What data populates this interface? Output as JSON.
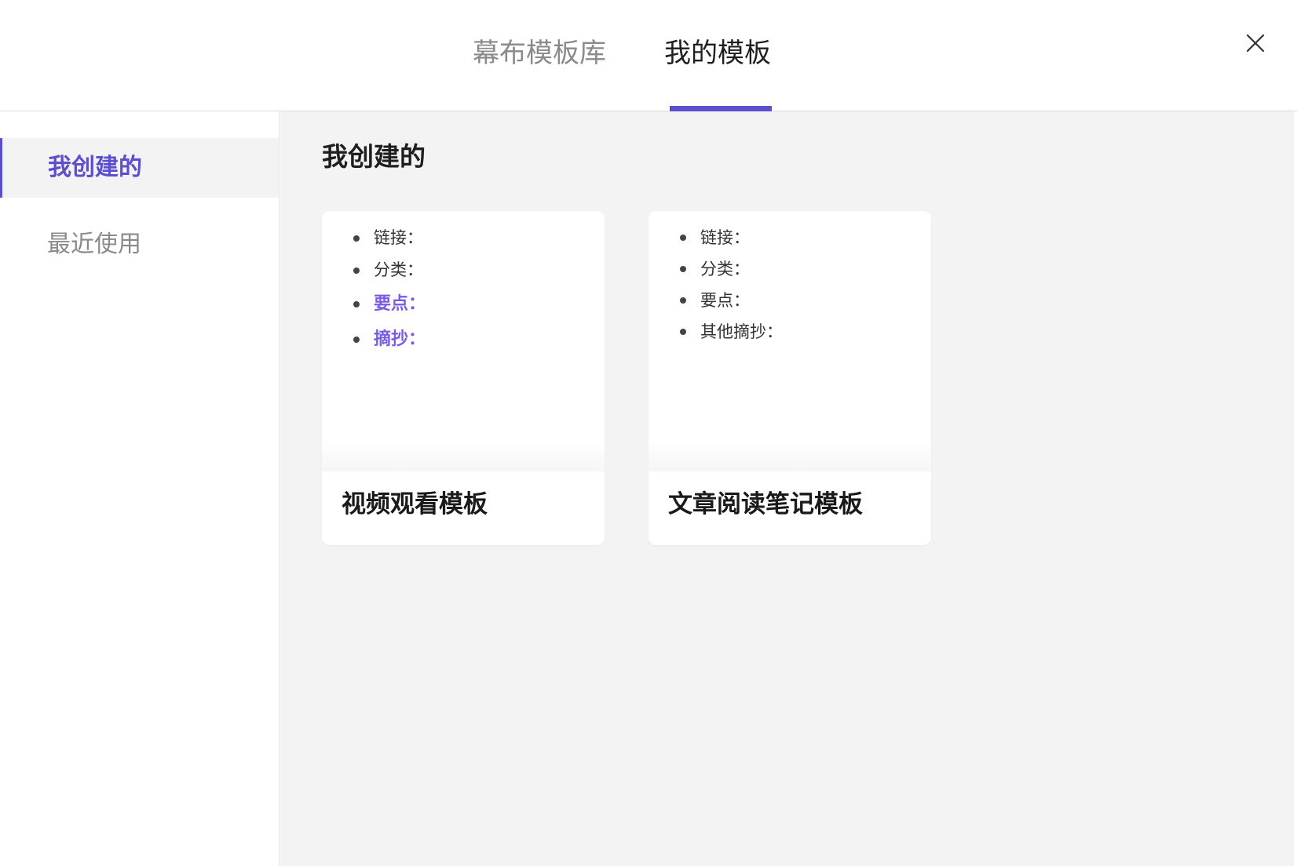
{
  "header": {
    "tabs": [
      {
        "label": "幕布模板库",
        "active": false
      },
      {
        "label": "我的模板",
        "active": true
      }
    ],
    "close_icon": "close-icon",
    "accent_color": "#5b4fcf"
  },
  "sidebar": {
    "items": [
      {
        "label": "我创建的",
        "active": true
      },
      {
        "label": "最近使用",
        "active": false
      }
    ]
  },
  "main": {
    "section_title": "我创建的",
    "cards": [
      {
        "title": "视频观看模板",
        "preview_items": [
          {
            "text": "链接：",
            "highlight": false
          },
          {
            "text": "分类：",
            "highlight": false
          },
          {
            "text": "要点：",
            "highlight": true
          },
          {
            "text": "摘抄：",
            "highlight": true
          }
        ]
      },
      {
        "title": "文章阅读笔记模板",
        "preview_items": [
          {
            "text": "链接：",
            "highlight": false
          },
          {
            "text": "分类：",
            "highlight": false
          },
          {
            "text": "要点：",
            "highlight": false
          },
          {
            "text": "其他摘抄：",
            "highlight": false
          }
        ]
      }
    ],
    "highlight_color": "#7a5be6"
  }
}
